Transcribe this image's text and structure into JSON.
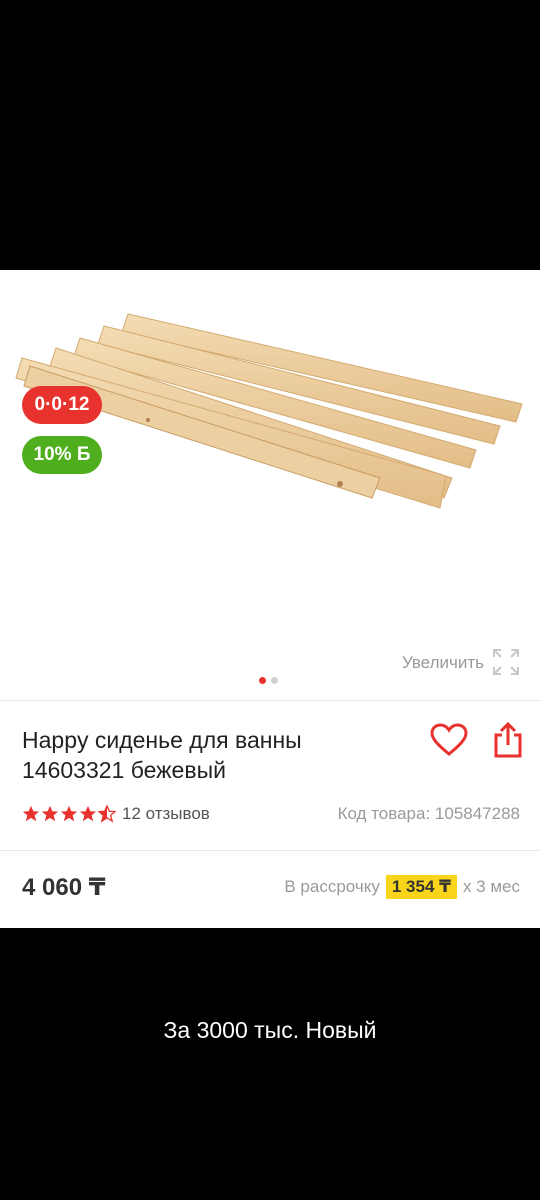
{
  "gallery": {
    "badges": {
      "installment": "0·0·12",
      "bonus": "10% Б"
    },
    "zoom_label": "Увеличить",
    "slides_total": 2,
    "slide_active": 1
  },
  "product": {
    "title": "Happy сиденье для ванны 14603321 бежевый",
    "rating": 4.5,
    "reviews": "12 отзывов",
    "sku": "Код товара: 105847288",
    "price": "4 060 ₸",
    "installment": {
      "prefix": "В рассрочку",
      "amount": "1 354 ₸",
      "suffix": "x 3 мес"
    }
  },
  "caption": "За 3000 тыс. Новый",
  "colors": {
    "accent_red": "#e8322d",
    "bonus_green": "#4fae1d",
    "installment_yellow": "#f8d51a"
  }
}
